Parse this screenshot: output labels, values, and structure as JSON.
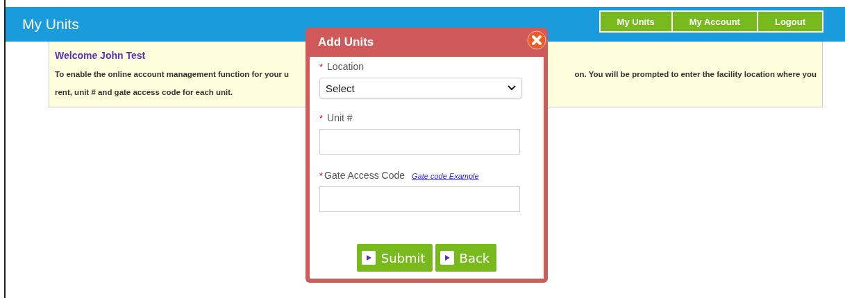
{
  "header": {
    "title": "My Units",
    "nav": [
      {
        "label": "My Units"
      },
      {
        "label": "My Account"
      },
      {
        "label": "Logout"
      }
    ]
  },
  "notice": {
    "heading": "Welcome John Test",
    "line_1_left": "To enable the online account management function for your u",
    "line_1_right": "on. You will be prompted to enter the facility location where you",
    "line_2": "rent, unit # and gate access code for each unit."
  },
  "dialog": {
    "title": "Add Units",
    "fields": [
      {
        "kind": "select",
        "required_mark": "*",
        "label": "Location",
        "value": "Select"
      },
      {
        "kind": "input",
        "required_mark": "*",
        "label": "Unit #"
      },
      {
        "kind": "input",
        "required_mark": "*",
        "label": "Gate Access Code",
        "link": "Gate code Example"
      }
    ],
    "buttons": [
      {
        "label": "Submit"
      },
      {
        "label": "Back"
      }
    ]
  }
}
